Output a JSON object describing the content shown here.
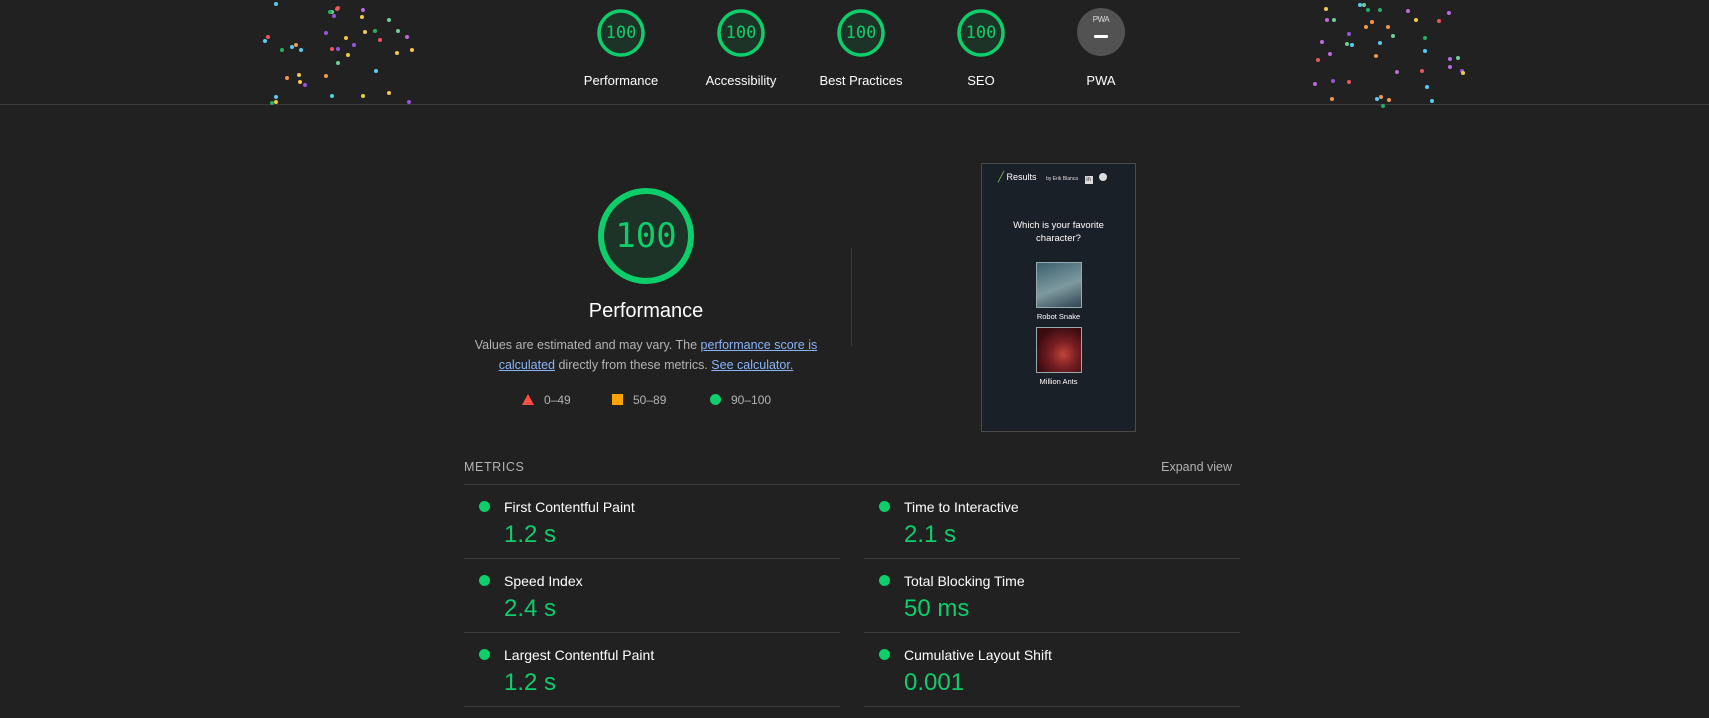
{
  "header": {
    "gauges": [
      {
        "score": "100",
        "label": "Performance"
      },
      {
        "score": "100",
        "label": "Accessibility"
      },
      {
        "score": "100",
        "label": "Best Practices"
      },
      {
        "score": "100",
        "label": "SEO"
      }
    ],
    "pwa": {
      "badge": "PWA",
      "label": "PWA"
    }
  },
  "performance": {
    "score": "100",
    "title": "Performance",
    "desc_prefix": "Values are estimated and may vary. The ",
    "link1": "performance score is calculated",
    "desc_mid": " directly from these metrics. ",
    "link2": "See calculator.",
    "legend": [
      {
        "range": "0–49",
        "shape": "triangle",
        "color": "#ff4e42"
      },
      {
        "range": "50–89",
        "shape": "square",
        "color": "#ffa400"
      },
      {
        "range": "90–100",
        "shape": "circle",
        "color": "#0cce6b"
      }
    ]
  },
  "screenshot": {
    "header_title": "Results",
    "byline": "by Erik Blanca",
    "logo_text": "Rick and Morty",
    "question": "Which is your favorite character?",
    "cards": [
      {
        "name": "Robot Snake"
      },
      {
        "name": "Million Ants"
      }
    ]
  },
  "metrics": {
    "heading": "METRICS",
    "expand": "Expand view",
    "left": [
      {
        "name": "First Contentful Paint",
        "value": "1.2 s"
      },
      {
        "name": "Speed Index",
        "value": "2.4 s"
      },
      {
        "name": "Largest Contentful Paint",
        "value": "1.2 s"
      }
    ],
    "right": [
      {
        "name": "Time to Interactive",
        "value": "2.1 s"
      },
      {
        "name": "Total Blocking Time",
        "value": "50 ms"
      },
      {
        "name": "Cumulative Layout Shift",
        "value": "0.001"
      }
    ]
  },
  "colors": {
    "pass": "#0cce6b",
    "average": "#ffa400",
    "fail": "#ff4e42",
    "background": "#212121"
  }
}
